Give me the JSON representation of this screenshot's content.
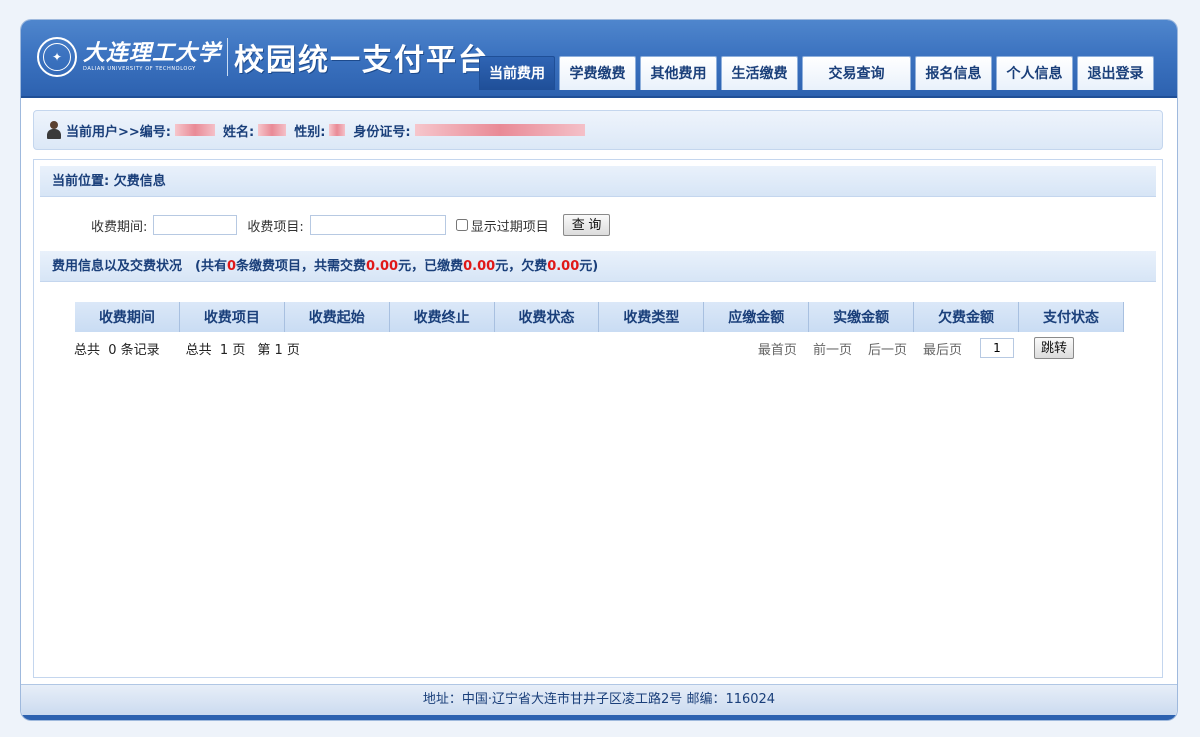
{
  "header": {
    "university_name": "大连理工大学",
    "university_en": "DALIAN UNIVERSITY OF TECHNOLOGY",
    "platform_title": "校园统一支付平台",
    "nav": [
      {
        "label": "当前费用",
        "active": true
      },
      {
        "label": "学费缴费",
        "active": false
      },
      {
        "label": "其他费用",
        "active": false
      },
      {
        "label": "生活缴费",
        "active": false
      },
      {
        "label": "交易查询",
        "active": false
      },
      {
        "label": "报名信息",
        "active": false
      },
      {
        "label": "个人信息",
        "active": false
      },
      {
        "label": "退出登录",
        "active": false
      }
    ]
  },
  "user_bar": {
    "prefix": "当前用户>>编号:",
    "name_label": "姓名:",
    "gender_label": "性别:",
    "id_label": "身份证号:"
  },
  "location": {
    "text": "当前位置: 欠费信息"
  },
  "search": {
    "period_label": "收费期间:",
    "period_value": "",
    "item_label": "收费项目:",
    "item_value": "",
    "show_expired_label": "显示过期项目",
    "show_expired_checked": false,
    "query_button": "查 询"
  },
  "fee_summary": {
    "prefix": "费用信息以及交费状况　(共有",
    "item_count": "0",
    "mid1": "条缴费项目，共需交费",
    "total_due": "0.00",
    "mid2": "元，已缴费",
    "paid": "0.00",
    "mid3": "元，欠费",
    "owed": "0.00",
    "suffix": "元)"
  },
  "table": {
    "columns": [
      "收费期间",
      "收费项目",
      "收费起始",
      "收费终止",
      "收费状态",
      "收费类型",
      "应缴金额",
      "实缴金额",
      "欠费金额",
      "支付状态"
    ],
    "rows": []
  },
  "pager": {
    "total_records": "总共  0 条记录",
    "total_pages": "总共  1 页",
    "current_page": "第 1 页",
    "first": "最首页",
    "prev": "前一页",
    "next": "后一页",
    "last": "最后页",
    "page_input": "1",
    "jump_button": "跳转"
  },
  "footer": {
    "address": "地址：中国·辽宁省大连市甘井子区凌工路2号 邮编：116024"
  },
  "colors": {
    "header_blue": "#3c73c0",
    "nav_active": "#1f4f98",
    "accent_red": "#e01818",
    "text_blue": "#1a3f7a"
  }
}
